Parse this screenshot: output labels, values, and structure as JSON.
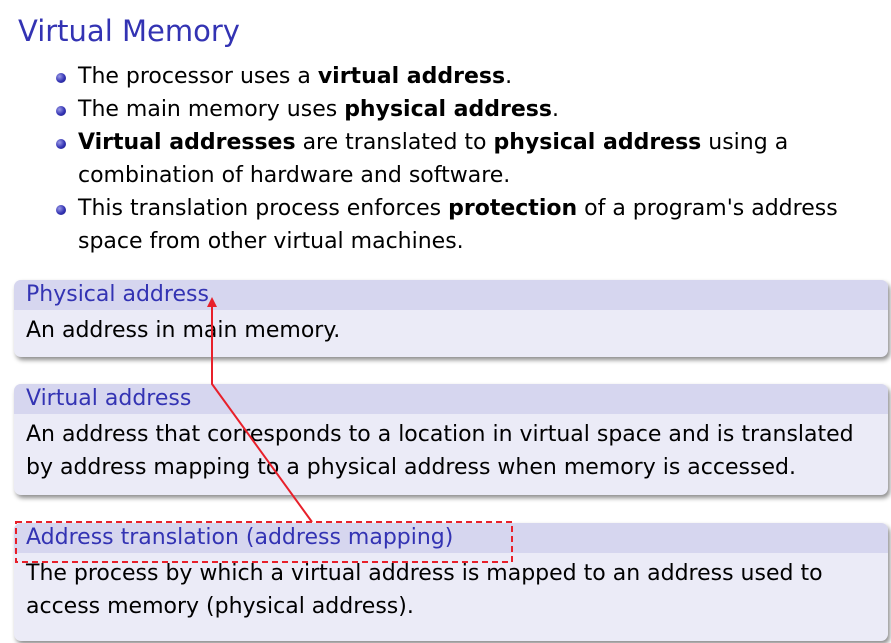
{
  "slide": {
    "title": "Virtual Memory"
  },
  "bullets": [
    {
      "parts": [
        {
          "text": "The processor uses a ",
          "bold": false
        },
        {
          "text": "virtual address",
          "bold": true
        },
        {
          "text": ".",
          "bold": false
        }
      ]
    },
    {
      "parts": [
        {
          "text": "The main memory uses ",
          "bold": false
        },
        {
          "text": "physical address",
          "bold": true
        },
        {
          "text": ".",
          "bold": false
        }
      ]
    },
    {
      "parts": [
        {
          "text": "Virtual addresses",
          "bold": true
        },
        {
          "text": " are translated to ",
          "bold": false
        },
        {
          "text": "physical address",
          "bold": true
        },
        {
          "text": " using a combination of hardware and software.",
          "bold": false
        }
      ]
    },
    {
      "parts": [
        {
          "text": "This translation process enforces ",
          "bold": false
        },
        {
          "text": "protection",
          "bold": true
        },
        {
          "text": " of a program's address space from other virtual machines.",
          "bold": false
        }
      ]
    }
  ],
  "blocks": {
    "physical": {
      "title": "Physical address",
      "body": "An address in main memory."
    },
    "virtual": {
      "title": "Virtual address",
      "body": "An address that corresponds to a location in virtual space and is translated by address mapping to a physical address when memory is accessed."
    },
    "translation": {
      "title": "Address translation (address mapping)",
      "body": "The process by which a virtual address is mapped to an address used to access memory (physical address)."
    }
  },
  "colors": {
    "title": "#3333b3",
    "block_header_bg": "#d6d6ef",
    "block_body_bg": "#ebebf7",
    "annotation": "#e8202a"
  }
}
